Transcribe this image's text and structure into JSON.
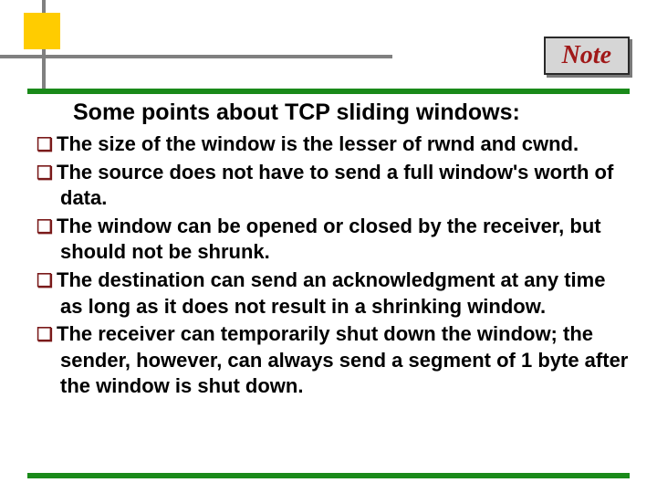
{
  "note_label": "Note",
  "heading": "Some points about TCP sliding windows:",
  "bullets": [
    "The size of the window is the lesser of rwnd and cwnd.",
    "The source does not have to send a full window's worth of data.",
    "The window can be opened or closed by the receiver, but should not be shrunk.",
    "The destination can send an acknowledgment at any time as long as it does not result in a shrinking window.",
    "The receiver can temporarily shut down the window; the sender, however, can always send a segment of 1 byte after the window is shut down."
  ],
  "bullet_glyph": "❏"
}
